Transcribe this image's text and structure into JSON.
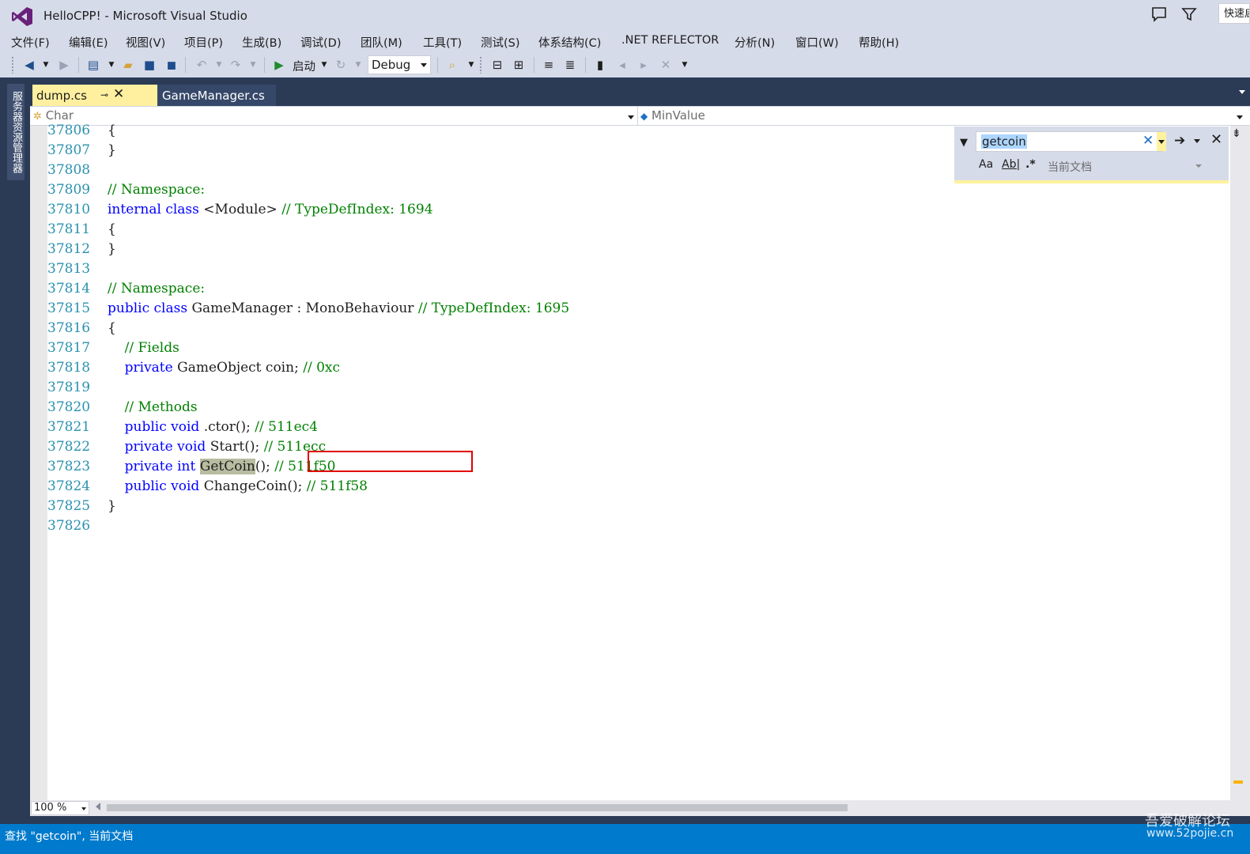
{
  "window": {
    "title": "HelloCPP! - Microsoft Visual Studio",
    "quick_launch": "快速启动"
  },
  "menu": [
    "文件(F)",
    "编辑(E)",
    "视图(V)",
    "项目(P)",
    "生成(B)",
    "调试(D)",
    "团队(M)",
    "工具(T)",
    "测试(S)",
    "体系结构(C)",
    ".NET REFLECTOR",
    "分析(N)",
    "窗口(W)",
    "帮助(H)"
  ],
  "toolbar": {
    "start_label": "启动",
    "config": "Debug"
  },
  "side_panel": {
    "label": "服务器资源管理器"
  },
  "tabs": [
    {
      "label": "dump.cs",
      "pin": "⊸",
      "close": "✕"
    },
    {
      "label": "GameManager.cs"
    }
  ],
  "nav": {
    "left": "Char",
    "right": "MinValue"
  },
  "find": {
    "query": "getcoin",
    "scope": "当前文档",
    "opt_case": "Aa",
    "opt_word": "Ab|",
    "opt_regex": ".*"
  },
  "code": {
    "lines": [
      {
        "n": "37806",
        "t": "{"
      },
      {
        "n": "37807",
        "t": "}"
      },
      {
        "n": "37808",
        "t": ""
      },
      {
        "n": "37809",
        "t": "// Namespace:"
      },
      {
        "n": "37810",
        "t": "internal class <Module> // TypeDefIndex: 1694"
      },
      {
        "n": "37811",
        "t": "{"
      },
      {
        "n": "37812",
        "t": "}"
      },
      {
        "n": "37813",
        "t": ""
      },
      {
        "n": "37814",
        "t": "// Namespace:"
      },
      {
        "n": "37815",
        "t": "public class GameManager : MonoBehaviour // TypeDefIndex: 1695"
      },
      {
        "n": "37816",
        "t": "{"
      },
      {
        "n": "37817",
        "t": "    // Fields"
      },
      {
        "n": "37818",
        "t": "    private GameObject coin; // 0xc"
      },
      {
        "n": "37819",
        "t": ""
      },
      {
        "n": "37820",
        "t": "    // Methods"
      },
      {
        "n": "37821",
        "t": "    public void .ctor(); // 511ec4"
      },
      {
        "n": "37822",
        "t": "    private void Start(); // 511ecc"
      },
      {
        "n": "37823",
        "t": "    private int GetCoin(); // 511f50"
      },
      {
        "n": "37824",
        "t": "    public void ChangeCoin(); // 511f58"
      },
      {
        "n": "37825",
        "t": "}"
      },
      {
        "n": "37826",
        "t": ""
      }
    ]
  },
  "zoom": "100 %",
  "status": {
    "text": "查找 \"getcoin\", 当前文档"
  },
  "watermark": {
    "line1": "吾爱破解论坛",
    "line2": "www.52pojie.cn"
  },
  "colors": {
    "keyword": "#0000ff",
    "comment": "#008000",
    "line_number": "#2b91af",
    "status_bar": "#007acc",
    "active_tab": "#fff0a0"
  }
}
